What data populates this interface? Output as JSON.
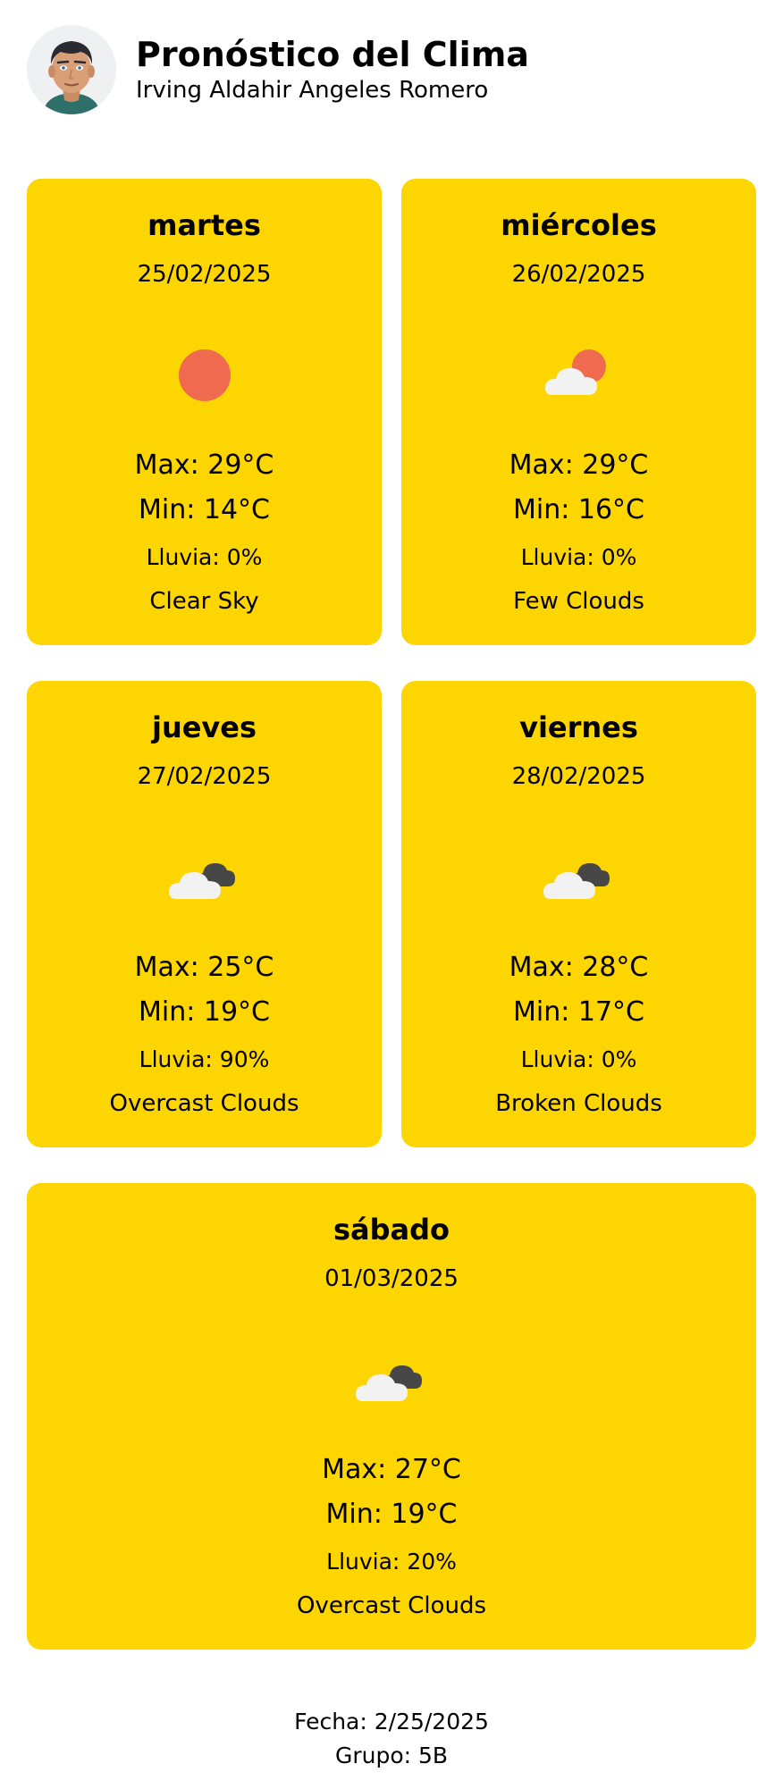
{
  "header": {
    "title": "Pronóstico del Clima",
    "subtitle": "Irving Aldahir Angeles Romero",
    "avatar_icon": "user-avatar-icon"
  },
  "colors": {
    "card_background": "#fdd500",
    "sun": "#f06a4f",
    "cloud_light": "#f2f2f2",
    "cloud_dark": "#474747"
  },
  "forecast": [
    {
      "day": "martes",
      "date": "25/02/2025",
      "icon": "clear-sky-icon",
      "max": "Max: 29°C",
      "min": "Min: 14°C",
      "rain": "Lluvia: 0%",
      "description": "Clear Sky"
    },
    {
      "day": "miércoles",
      "date": "26/02/2025",
      "icon": "few-clouds-icon",
      "max": "Max: 29°C",
      "min": "Min: 16°C",
      "rain": "Lluvia: 0%",
      "description": "Few Clouds"
    },
    {
      "day": "jueves",
      "date": "27/02/2025",
      "icon": "overcast-clouds-icon",
      "max": "Max: 25°C",
      "min": "Min: 19°C",
      "rain": "Lluvia: 90%",
      "description": "Overcast Clouds"
    },
    {
      "day": "viernes",
      "date": "28/02/2025",
      "icon": "broken-clouds-icon",
      "max": "Max: 28°C",
      "min": "Min: 17°C",
      "rain": "Lluvia: 0%",
      "description": "Broken Clouds"
    },
    {
      "day": "sábado",
      "date": "01/03/2025",
      "icon": "overcast-clouds-icon",
      "max": "Max: 27°C",
      "min": "Min: 19°C",
      "rain": "Lluvia: 20%",
      "description": "Overcast Clouds"
    }
  ],
  "footer": {
    "date": "Fecha: 2/25/2025",
    "group": "Grupo: 5B"
  }
}
